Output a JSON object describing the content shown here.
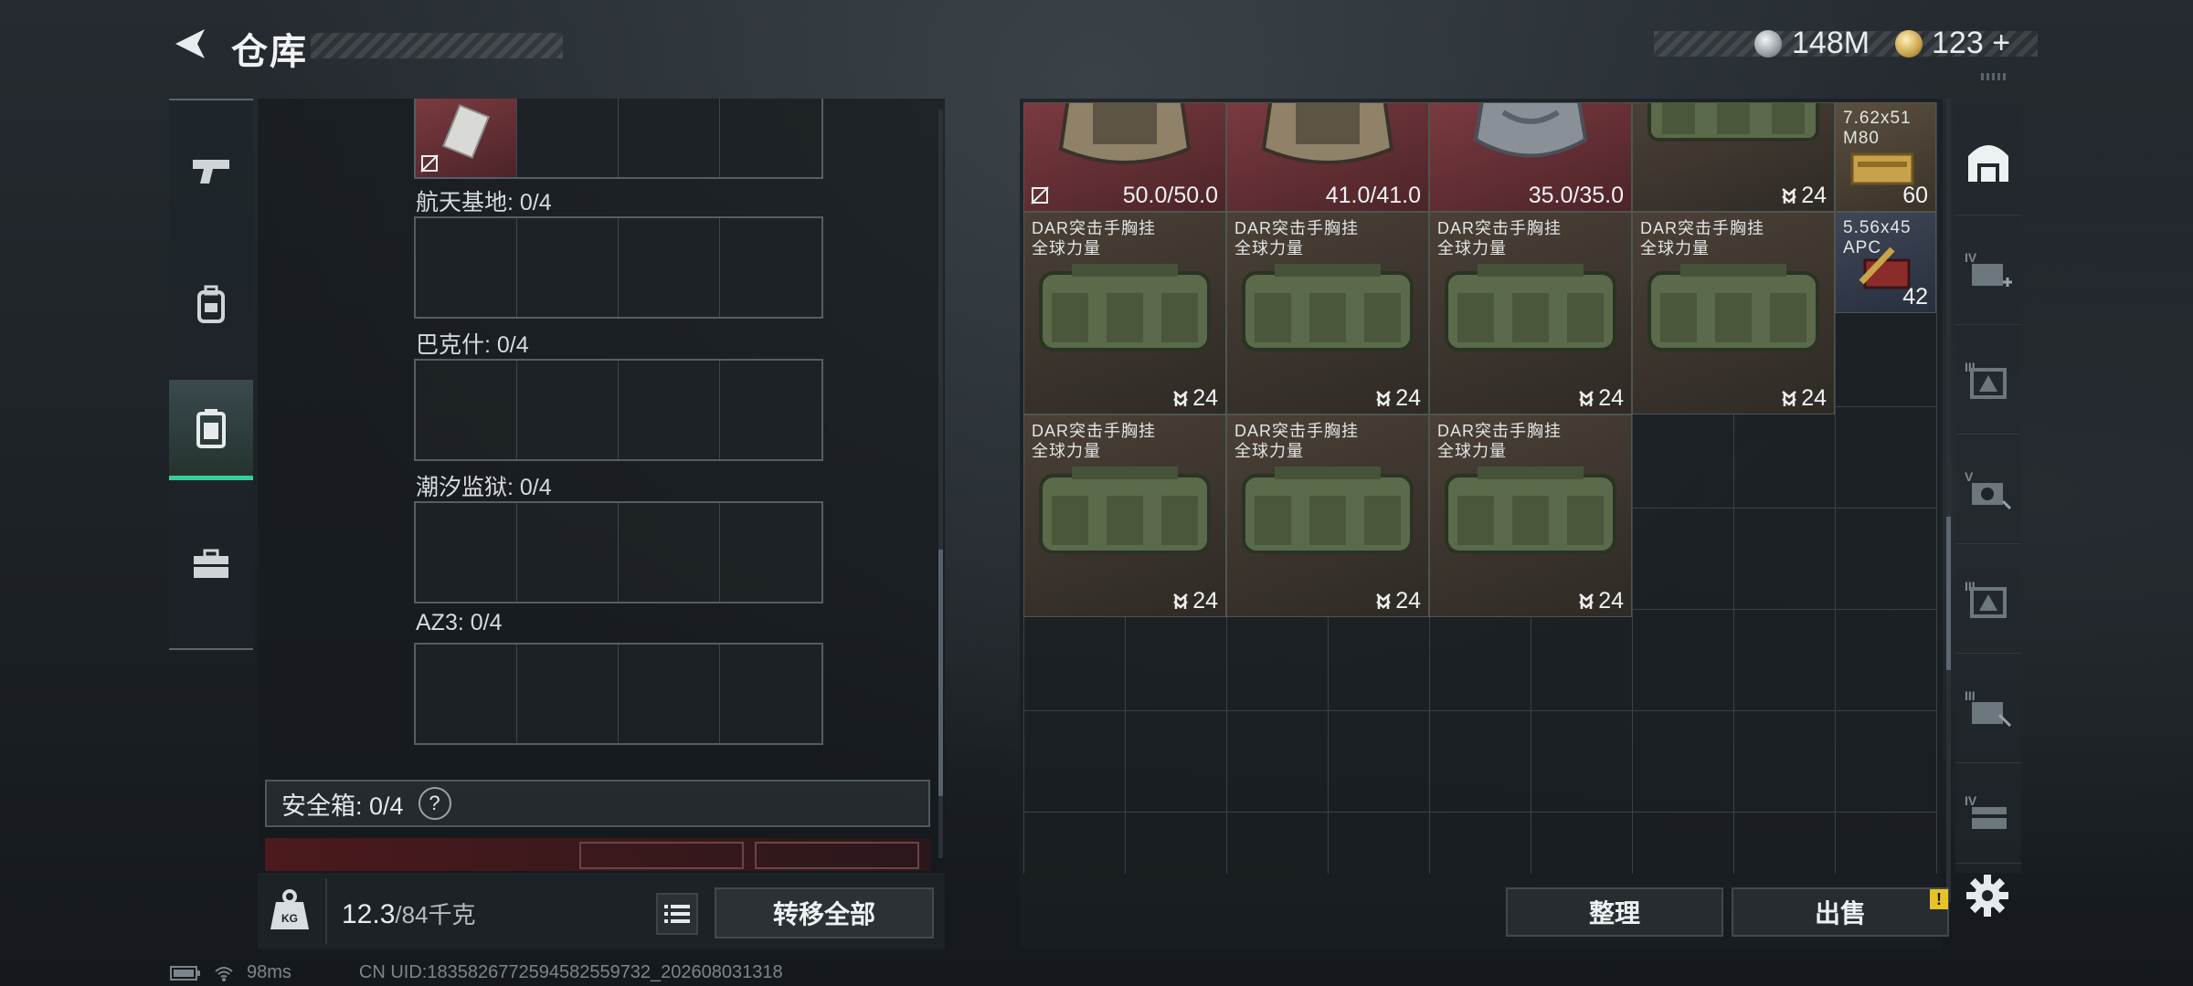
{
  "header": {
    "title": "仓库"
  },
  "currency": {
    "silver": "148M",
    "gold": "123",
    "gold_plus": "+"
  },
  "left_sidebar": [
    "weapon-tab",
    "backpack-tab",
    "safebox-tab",
    "case-tab"
  ],
  "left_panel": {
    "regions": [
      {
        "label": "航天基地: 0/4"
      },
      {
        "label": "巴克什: 0/4"
      },
      {
        "label": "潮汐监狱: 0/4"
      },
      {
        "label": "AZ3: 0/4"
      }
    ],
    "safe_box": {
      "label": "安全箱:  0/4",
      "help": "?"
    },
    "weight": {
      "value": "12.3",
      "max": "/84千克",
      "icon_text": "KG"
    },
    "transfer_all": "转移全部"
  },
  "items": {
    "row1": [
      {
        "type": "helmet",
        "durability": "50.0/50.0"
      },
      {
        "type": "helmet",
        "durability": "41.0/41.0"
      },
      {
        "type": "helmet",
        "durability": "35.0/35.0"
      },
      {
        "type": "bag",
        "count": "24"
      },
      {
        "type": "ammo",
        "name": "7.62x51 M80",
        "count": "60"
      }
    ],
    "bags": [
      {
        "name": "DAR突击手胸挂",
        "brand": "全球力量",
        "count": "24"
      },
      {
        "name": "DAR突击手胸挂",
        "brand": "全球力量",
        "count": "24"
      },
      {
        "name": "DAR突击手胸挂",
        "brand": "全球力量",
        "count": "24"
      },
      {
        "name": "DAR突击手胸挂",
        "brand": "全球力量",
        "count": "24"
      },
      {
        "name": "DAR突击手胸挂",
        "brand": "全球力量",
        "count": "24"
      },
      {
        "name": "DAR突击手胸挂",
        "brand": "全球力量",
        "count": "24"
      },
      {
        "name": "DAR突击手胸挂",
        "brand": "全球力量",
        "count": "24"
      }
    ],
    "ammo2": {
      "name": "5.56x45 APC",
      "count": "42"
    }
  },
  "right_tabs": [
    "IV",
    "III",
    "V",
    "III",
    "III",
    "IV"
  ],
  "buttons": {
    "organize": "整理",
    "sell": "出售",
    "sell_badge": "!"
  },
  "status": {
    "ping": "98ms",
    "uid": "CN UID:1835826772594582559732_202608031318"
  },
  "colors": {
    "accent": "#2fd29b",
    "warning": "#e8c326",
    "item_red": "#7a3a40"
  }
}
